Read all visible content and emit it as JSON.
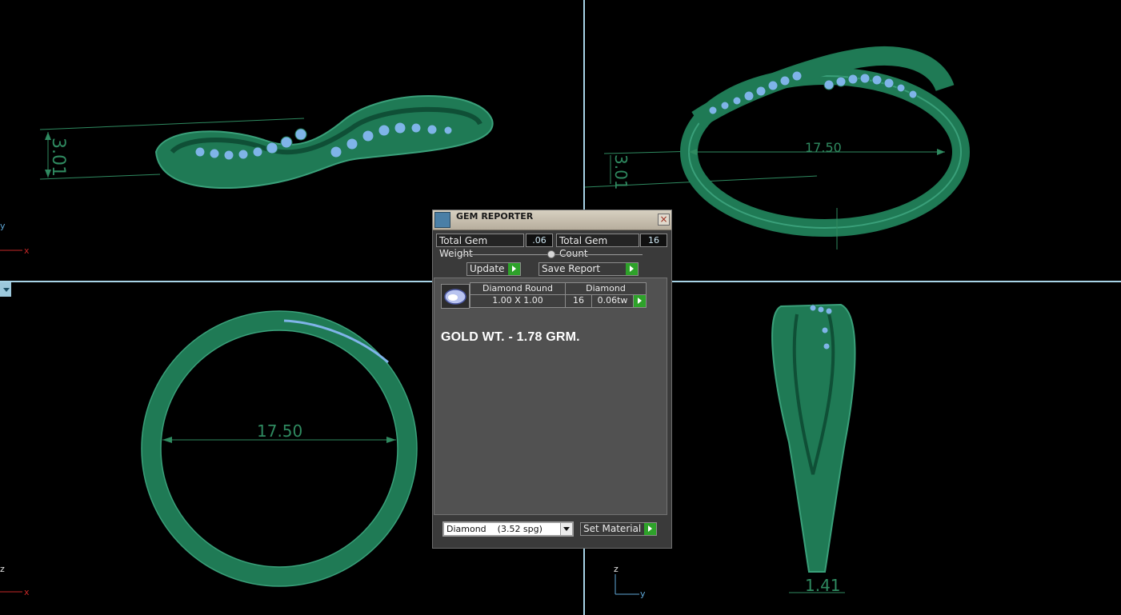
{
  "dialog": {
    "title": "GEM REPORTER",
    "close_label": "×",
    "total_gem_weight_label": "Total Gem Weight",
    "total_gem_weight_value": ".06",
    "total_gem_count_label": "Total Gem Count",
    "total_gem_count_value": "16",
    "update_label": "Update",
    "save_report_label": "Save Report",
    "table": {
      "gem_name": "Diamond Round",
      "gem_type": "Diamond",
      "size": "1.00 X 1.00",
      "count": "16",
      "weight": "0.06tw"
    },
    "note": "GOLD WT. - 1.78 GRM.",
    "material_select": "Diamond    (3.52 spg)",
    "set_material_label": "Set Material"
  },
  "viewports": {
    "top_left": {
      "dimension": "3.01",
      "axis_y": "y",
      "axis_x": "x"
    },
    "top_right": {
      "dimension_width": "17.50",
      "dimension_height": "3.01"
    },
    "bottom_left": {
      "dimension": "17.50",
      "axis_z": "z",
      "axis_x": "x"
    },
    "bottom_right": {
      "dimension": "1.41",
      "axis_z": "z",
      "axis_y": "y"
    }
  },
  "colors": {
    "metal": "#1f7a55",
    "metal_light": "#3aa07a",
    "gem": "#7fb4e8",
    "dimension": "#2f8a60",
    "axis_red": "#c62828",
    "axis_blue": "#5fa8d8",
    "divider": "#a7d3e6"
  }
}
